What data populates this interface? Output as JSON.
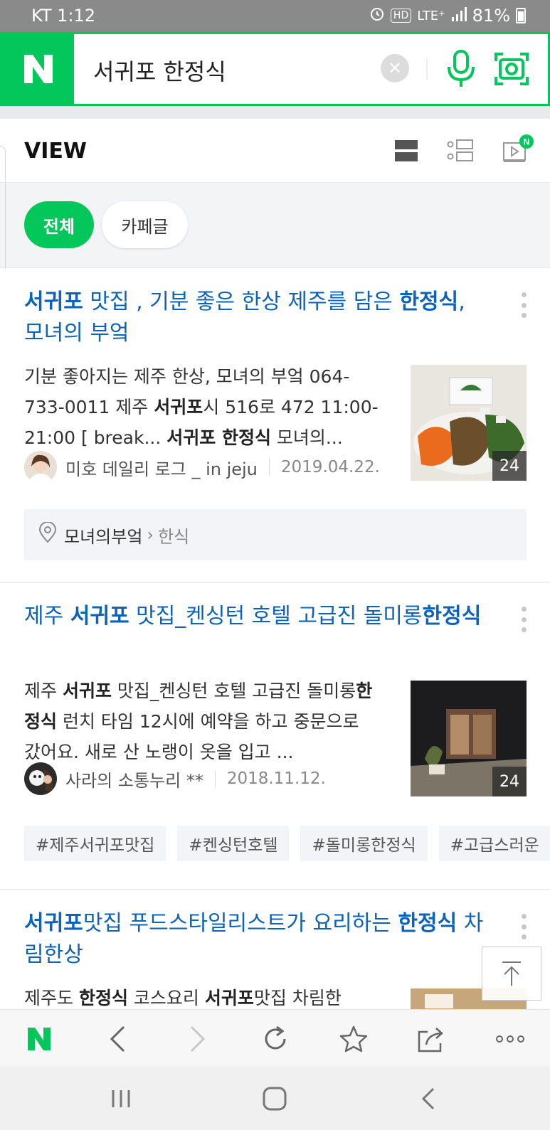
{
  "status_bar": {
    "carrier_time": "KT 1:12",
    "hd_label": "HD",
    "network": "LTE⁺",
    "battery": "81%"
  },
  "search": {
    "logo_letter": "N",
    "query": "서귀포 한정식",
    "clear_icon": "close-icon",
    "mic_icon": "microphone-icon",
    "lens_icon": "camera-lens-icon"
  },
  "view_header": {
    "title": "VIEW",
    "badge": "N"
  },
  "filters": [
    {
      "label": "전체",
      "active": true
    },
    {
      "label": "카페글",
      "active": false
    }
  ],
  "results": [
    {
      "title_segments": [
        {
          "text": "서귀포",
          "bold": true
        },
        {
          "text": " 맛집 , 기분 좋은 한상 제주를 담은 ",
          "bold": false
        },
        {
          "text": "한정식",
          "bold": true
        },
        {
          "text": ", 모녀의 부엌",
          "bold": false
        }
      ],
      "desc_segments": [
        {
          "text": "기분 좋아지는 제주 한상, 모녀의 부엌 064-733-0011 제주 ",
          "bold": false
        },
        {
          "text": "서귀포",
          "bold": true
        },
        {
          "text": "시 516로 472 11:00- 21:00 [ break... ",
          "bold": false
        },
        {
          "text": "서귀포 한정식",
          "bold": true
        },
        {
          "text": " 모녀의...",
          "bold": false
        }
      ],
      "author": "미호 데일리 로그 _ in jeju",
      "date": "2019.04.22.",
      "thumb_count": "24",
      "place": {
        "name": "모녀의부엌",
        "arrow": "›",
        "category": "한식"
      }
    },
    {
      "title_segments": [
        {
          "text": "제주 ",
          "bold": false
        },
        {
          "text": "서귀포",
          "bold": true
        },
        {
          "text": " 맛집_켄싱턴 호텔 고급진 돌미롱",
          "bold": false
        },
        {
          "text": "한정식",
          "bold": true
        }
      ],
      "desc_segments": [
        {
          "text": "제주 ",
          "bold": false
        },
        {
          "text": "서귀포",
          "bold": true
        },
        {
          "text": " 맛집_켄싱턴 호텔 고급진 돌미롱",
          "bold": false
        },
        {
          "text": "한정식",
          "bold": true
        },
        {
          "text": " 런치 타임 12시에 예약을 하고 중문으로 갔어요. 새로 산 노랭이 옷을 입고 ...",
          "bold": false
        }
      ],
      "author": "사라의 소통누리 **",
      "date": "2018.11.12.",
      "thumb_count": "24",
      "tags": [
        "#제주서귀포맛집",
        "#켄싱턴호텔",
        "#돌미롱한정식",
        "#고급스러운"
      ]
    },
    {
      "title_segments": [
        {
          "text": "서귀포",
          "bold": true
        },
        {
          "text": "맛집 푸드스타일리스트가 요리하는 ",
          "bold": false
        },
        {
          "text": "한정식",
          "bold": true
        },
        {
          "text": " 차림한상",
          "bold": false
        }
      ],
      "desc_segments": [
        {
          "text": "제주도 ",
          "bold": false
        },
        {
          "text": "한정식",
          "bold": true
        },
        {
          "text": " 코스요리 ",
          "bold": false
        },
        {
          "text": "서귀포",
          "bold": true
        },
        {
          "text": "맛집 차림한",
          "bold": false
        }
      ]
    }
  ],
  "browser_bar": {
    "icons": [
      "naver-home-icon",
      "back-icon",
      "forward-icon",
      "refresh-icon",
      "bookmark-star-icon",
      "share-icon",
      "more-icon"
    ]
  },
  "colors": {
    "brand_green": "#03c75a",
    "title_blue": "#0e63b6"
  }
}
